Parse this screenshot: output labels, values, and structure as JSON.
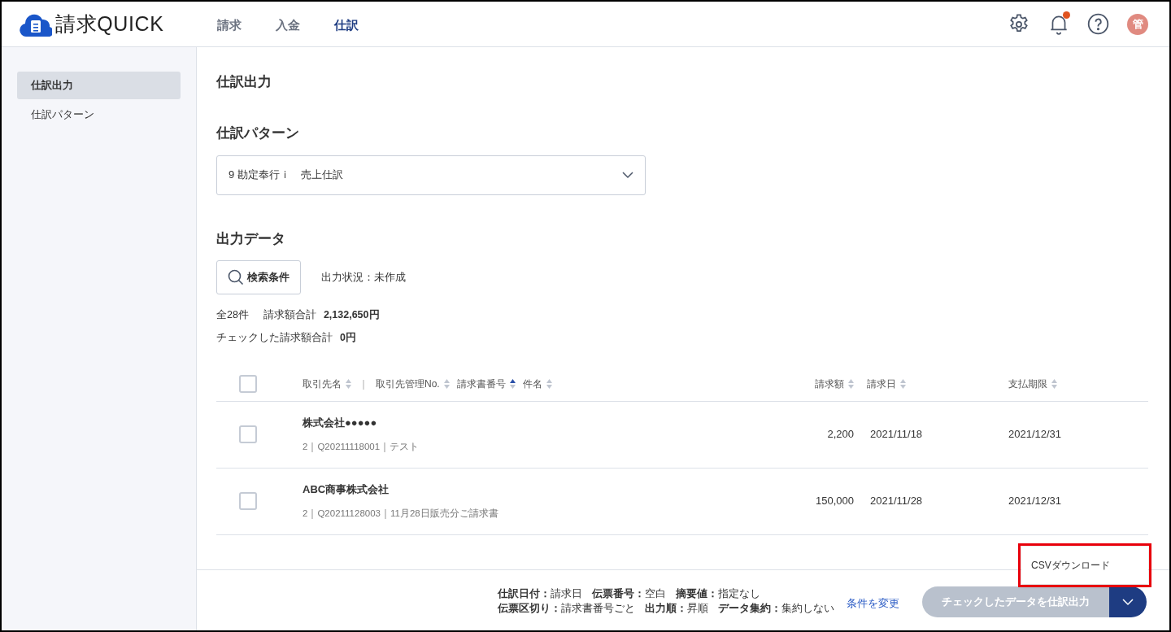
{
  "header": {
    "logo_text": "請求QUICK",
    "nav": [
      {
        "label": "請求",
        "selected": false
      },
      {
        "label": "入金",
        "selected": false
      },
      {
        "label": "仕訳",
        "selected": true
      }
    ],
    "notification_dot": true,
    "avatar": "管"
  },
  "sidebar": {
    "items": [
      {
        "label": "仕訳出力",
        "selected": true
      },
      {
        "label": "仕訳パターン",
        "selected": false
      }
    ]
  },
  "page_title": "仕訳出力",
  "pattern": {
    "heading": "仕訳パターン",
    "value": "9 勘定奉行ｉ　売上仕訳"
  },
  "output": {
    "heading": "出力データ",
    "search_button": "検索条件",
    "status": "出力状況：未作成",
    "total_count": "全28件",
    "total_label": "請求額合計",
    "total_value": "2,132,650円",
    "checked_label": "チェックした請求額合計",
    "checked_value": "0円"
  },
  "table": {
    "select_all_checked": false,
    "name_columns": [
      {
        "kind": "column",
        "label": "取引先名",
        "sorted": false
      },
      {
        "kind": "separator",
        "label": "｜"
      },
      {
        "kind": "column",
        "label": "取引先管理No.",
        "sorted": false
      },
      {
        "kind": "column",
        "label": "請求書番号",
        "sorted": true
      },
      {
        "kind": "column",
        "label": "件名",
        "sorted": false
      }
    ],
    "amount_column": {
      "label": "請求額",
      "sorted": false
    },
    "date_column": {
      "label": "請求日",
      "sorted": false
    },
    "due_column": {
      "label": "支払期限",
      "sorted": false
    },
    "rows": [
      {
        "checked": false,
        "name": "株式会社●●●●●",
        "detail": "2｜Q20211118001｜テスト",
        "amount": "2,200",
        "date": "2021/11/18",
        "due": "2021/12/31"
      },
      {
        "checked": false,
        "name": "ABC商事株式会社",
        "detail": "2｜Q20211128003｜11月28日販売分ご請求書",
        "amount": "150,000",
        "date": "2021/11/28",
        "due": "2021/12/31"
      }
    ]
  },
  "footer": {
    "settings": [
      [
        {
          "label": "仕訳日付：",
          "value": "請求日"
        },
        {
          "label": "伝票番号：",
          "value": "空白"
        },
        {
          "label": "摘要値：",
          "value": "指定なし"
        }
      ],
      [
        {
          "label": "伝票区切り：",
          "value": "請求書番号ごと"
        },
        {
          "label": "出力順：",
          "value": "昇順"
        },
        {
          "label": "データ集約：",
          "value": "集約しない"
        }
      ]
    ],
    "change_link": "条件を変更",
    "export_button": {
      "label": "チェックしたデータを仕訳出力",
      "disabled": true
    },
    "menu_expanded": true,
    "menu_items": [
      "CSVダウンロード"
    ],
    "highlight": true
  }
}
